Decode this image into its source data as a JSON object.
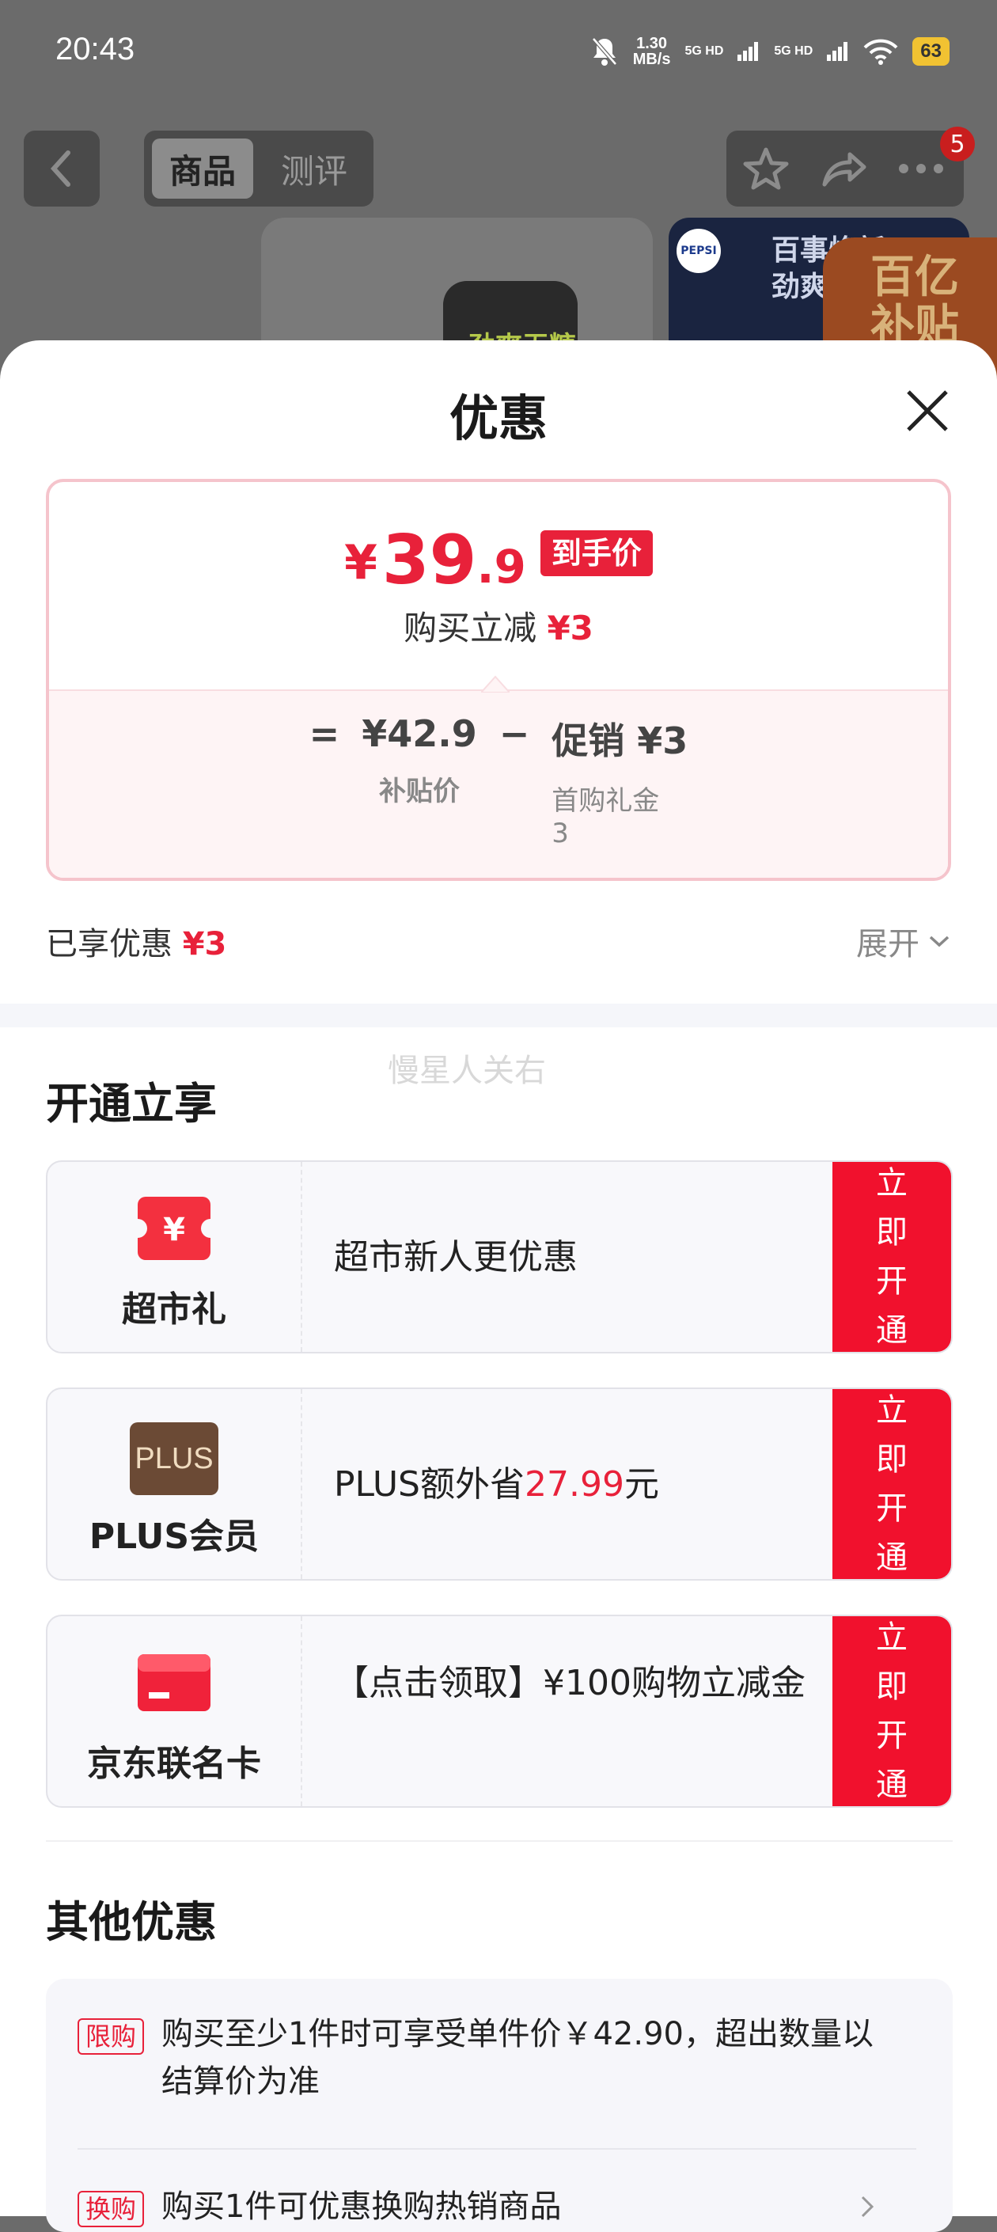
{
  "status_bar": {
    "time": "20:43",
    "speed_value": "1.30",
    "speed_unit": "MB/s",
    "signal1": "5G HD",
    "signal2": "5G HD",
    "battery": "63"
  },
  "top_nav": {
    "tabs": [
      {
        "label": "商品"
      },
      {
        "label": "测评"
      }
    ],
    "more_badge": "5"
  },
  "background": {
    "promo_text": "百亿补贴",
    "product_text1": "百事焕新",
    "product_text2": "劲爽无糖",
    "can_text": "劲爽无糖",
    "pepsi": "PEPSI"
  },
  "sheet": {
    "title": "优惠",
    "price": {
      "currency": "¥",
      "integer": "39",
      "decimal": ".9",
      "tag": "到手价",
      "instant_prefix": "购买立减",
      "instant_value": "¥3"
    },
    "formula": {
      "equals": "=",
      "base_price": "¥42.9",
      "base_label": "补贴价",
      "minus": "−",
      "promo": "促销 ¥3",
      "promo_sub_label": "首购礼金",
      "promo_sub_value": "3"
    },
    "enjoyed_label": "已享优惠",
    "enjoyed_value": "¥3",
    "expand_label": "展开",
    "watermark": "慢星人关右"
  },
  "open_section": {
    "title": "开通立享",
    "offers": [
      {
        "name": "超市礼",
        "icon": "yen-coupon-icon",
        "desc": "超市新人更优惠",
        "button": "立即开通"
      },
      {
        "name": "PLUS会员",
        "icon": "plus-badge-icon",
        "icon_text": "PLUS",
        "desc_prefix": "PLUS额外省",
        "desc_value": "27.99",
        "desc_suffix": "元",
        "button": "立即开通"
      },
      {
        "name": "京东联名卡",
        "icon": "card-icon",
        "desc": "【点击领取】¥100购物立减金",
        "button": "立即开通"
      }
    ]
  },
  "other_section": {
    "title": "其他优惠",
    "items": [
      {
        "tag": "限购",
        "text": "购买至少1件时可享受单件价￥42.90，超出数量以结算价为准"
      },
      {
        "tag": "换购",
        "text": "购买1件可优惠换购热销商品"
      }
    ]
  },
  "colors": {
    "accent_red": "#e8213a",
    "button_red": "#f1112d",
    "overlay": "#6b6b6b"
  }
}
